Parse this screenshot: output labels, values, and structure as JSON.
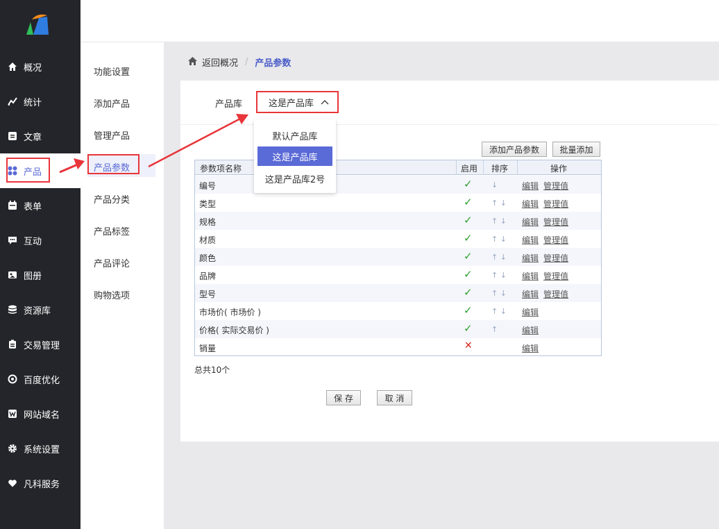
{
  "sidebar": {
    "items": [
      {
        "label": "概况",
        "icon": "home-icon"
      },
      {
        "label": "统计",
        "icon": "chart-icon"
      },
      {
        "label": "文章",
        "icon": "article-icon"
      },
      {
        "label": "产品",
        "icon": "grid-icon"
      },
      {
        "label": "表单",
        "icon": "calendar-icon"
      },
      {
        "label": "互动",
        "icon": "chat-icon"
      },
      {
        "label": "图册",
        "icon": "image-icon"
      },
      {
        "label": "资源库",
        "icon": "database-icon"
      },
      {
        "label": "交易管理",
        "icon": "clipboard-icon"
      },
      {
        "label": "百度优化",
        "icon": "target-icon"
      },
      {
        "label": "网站域名",
        "icon": "w-icon"
      },
      {
        "label": "系统设置",
        "icon": "gear-icon"
      },
      {
        "label": "凡科服务",
        "icon": "heart-icon"
      }
    ]
  },
  "subnav": {
    "items": [
      "功能设置",
      "添加产品",
      "管理产品",
      "产品参数",
      "产品分类",
      "产品标签",
      "产品评论",
      "购物选项"
    ]
  },
  "breadcrumb": {
    "back": "返回概况",
    "separator": "/",
    "current": "产品参数"
  },
  "library": {
    "label": "产品库",
    "selected": "这是产品库",
    "options": [
      "默认产品库",
      "这是产品库",
      "这是产品库2号"
    ]
  },
  "toolbar": {
    "add_param": "添加产品参数",
    "batch_add": "批量添加"
  },
  "table": {
    "headers": {
      "name": "参数项名称",
      "enabled": "启用",
      "sort": "排序",
      "actions": "操作"
    },
    "edit_label": "编辑",
    "manage_label": "管理值",
    "rows": [
      {
        "name": "编号",
        "enabled": "✓",
        "sort": "↓"
      },
      {
        "name": "类型",
        "enabled": "✓",
        "sort": "↑ ↓"
      },
      {
        "name": "规格",
        "enabled": "✓",
        "sort": "↑ ↓"
      },
      {
        "name": "材质",
        "enabled": "✓",
        "sort": "↑ ↓"
      },
      {
        "name": "颜色",
        "enabled": "✓",
        "sort": "↑ ↓"
      },
      {
        "name": "品牌",
        "enabled": "✓",
        "sort": "↑ ↓"
      },
      {
        "name": "型号",
        "enabled": "✓",
        "sort": "↑ ↓"
      },
      {
        "name": "市场价( 市场价 )",
        "enabled": "✓",
        "sort": "↑ ↓"
      },
      {
        "name": "价格( 实际交易价 )",
        "enabled": "✓",
        "sort": "↑"
      },
      {
        "name": "销量",
        "enabled": "✕",
        "sort": ""
      }
    ]
  },
  "total": "总共10个",
  "actions": {
    "save": "保 存",
    "cancel": "取 消"
  }
}
